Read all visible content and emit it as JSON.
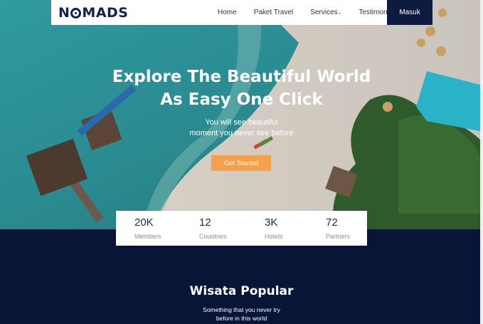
{
  "brand": {
    "logo_text_left": "N",
    "logo_text_right": "MADS"
  },
  "nav": {
    "links": [
      "Home",
      "Paket Travel",
      "Services",
      "Testimonial"
    ],
    "login_label": "Masuk"
  },
  "hero": {
    "title_line1": "Explore The Beautiful World",
    "title_line2": "As Easy One Click",
    "subtitle_line1": "You will see beautiful",
    "subtitle_line2": "moment you never see before",
    "cta_label": "Get Started"
  },
  "stats": [
    {
      "value": "20K",
      "label": "Members"
    },
    {
      "value": "12",
      "label": "Countries"
    },
    {
      "value": "3K",
      "label": "Hotels"
    },
    {
      "value": "72",
      "label": "Partners"
    }
  ],
  "popular": {
    "title": "Wisata Popular",
    "subtitle_line1": "Something that you never try",
    "subtitle_line2": "before in this world"
  },
  "colors": {
    "navy": "#0c1b3e",
    "section_bg": "#081537",
    "accent_orange": "#f5a04d",
    "sea": "#2e8f95"
  }
}
